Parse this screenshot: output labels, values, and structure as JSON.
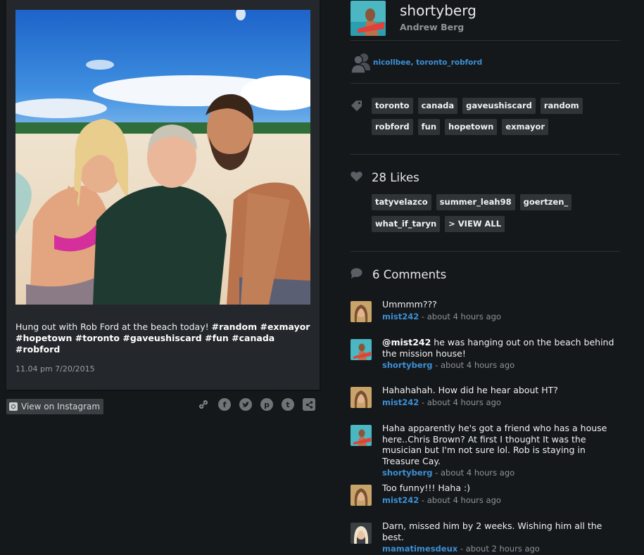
{
  "post": {
    "caption_plain": "Hung out with Rob Ford at the beach today!",
    "caption_tags_line1": "#random #exmayor",
    "caption_tags_line2": "#hopetown #toronto #gaveushiscard #fun #canada #robford",
    "timestamp": "11.04 pm 7/20/2015",
    "view_on_instagram": "View on Instagram"
  },
  "share": {
    "icons": [
      "link-icon",
      "facebook-icon",
      "twitter-icon",
      "pinterest-icon",
      "tumblr-icon",
      "share-icon"
    ],
    "glyphs": [
      "⛓",
      "f",
      "t",
      "p",
      "t",
      "<"
    ]
  },
  "profile": {
    "username": "shortyberg",
    "full_name": "Andrew Berg"
  },
  "tagged_people": "nicollbee, toronto_robford",
  "tags": [
    "toronto",
    "canada",
    "gaveushiscard",
    "random",
    "robford",
    "fun",
    "hopetown",
    "exmayor"
  ],
  "likes": {
    "count_label": "28 Likes",
    "users": [
      "tatyvelazco",
      "summer_leah98",
      "goertzen_",
      "what_if_taryn"
    ],
    "view_all": "> VIEW ALL"
  },
  "comments": {
    "count_label": "6 Comments",
    "items": [
      {
        "mention": "",
        "text": "Ummmm???",
        "user": "mist242",
        "time": " - about 4 hours ago",
        "avatar": "mist"
      },
      {
        "mention": "@mist242",
        "text": " he was hanging out on the beach behind the mission house!",
        "user": "shortyberg",
        "time": " - about 4 hours ago",
        "avatar": "shorty"
      },
      {
        "mention": "",
        "text": "Hahahahah. How did he hear about HT?",
        "user": "mist242",
        "time": " - about 4 hours ago",
        "avatar": "mist"
      },
      {
        "mention": "",
        "text": "Haha apparently he's got a friend who has a house here..Chris Brown? At first I thought It was the musician but I'm not sure lol. Rob is staying in Treasure Cay.",
        "user": "shortyberg",
        "time": " - about 4 hours ago",
        "avatar": "shorty"
      },
      {
        "mention": "",
        "text": "Too funny!!! Haha :)",
        "user": "mist242",
        "time": " - about 4 hours ago",
        "avatar": "mist"
      },
      {
        "mention": "",
        "text": "Darn, missed him by 2 weeks. Wishing him all the best.",
        "user": "mamatimesdeux",
        "time": " - about 2 hours ago",
        "avatar": "mama"
      }
    ]
  }
}
